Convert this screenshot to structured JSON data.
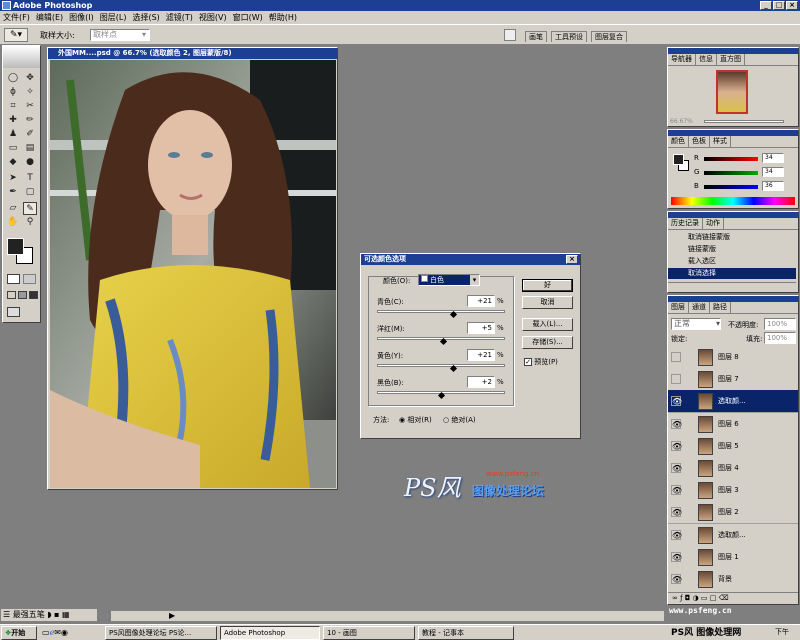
{
  "app": {
    "title": "Adobe Photoshop"
  },
  "menu": [
    "文件(F)",
    "编辑(E)",
    "图像(I)",
    "图层(L)",
    "选择(S)",
    "滤镜(T)",
    "视图(V)",
    "窗口(W)",
    "帮助(H)"
  ],
  "options": {
    "sample_label": "取样大小:",
    "sample_value": "取样点"
  },
  "palette_tabs": [
    "画笔",
    "工具预设",
    "图层复合"
  ],
  "document": {
    "title": "外国MM....psd @ 66.7% (选取颜色 2, 图层蒙版/8)"
  },
  "navigator": {
    "tabs": [
      "导航器",
      "信息",
      "直方图"
    ],
    "zoom": "66.67%"
  },
  "color_panel": {
    "tabs": [
      "颜色",
      "色板",
      "样式"
    ],
    "r": "34",
    "g": "34",
    "b": "36"
  },
  "history": {
    "tabs": [
      "历史记录",
      "动作"
    ],
    "items": [
      "取消链接蒙版",
      "链接蒙版",
      "载入选区",
      "取消选择"
    ]
  },
  "layers_panel": {
    "tabs": [
      "图层",
      "通道",
      "路径"
    ],
    "blend_mode": "正常",
    "opacity_label": "不透明度:",
    "opacity": "100%",
    "lock_label": "锁定:",
    "fill_label": "填充:",
    "fill": "100%",
    "layers": [
      {
        "name": "图层 8",
        "selected": false,
        "eye": false
      },
      {
        "name": "图层 7",
        "selected": false,
        "eye": false
      },
      {
        "name": "选取颜...",
        "selected": true,
        "eye": true
      },
      {
        "name": "图层 6",
        "selected": false,
        "eye": true
      },
      {
        "name": "图层 5",
        "selected": false,
        "eye": true
      },
      {
        "name": "图层 4",
        "selected": false,
        "eye": true
      },
      {
        "name": "图层 3",
        "selected": false,
        "eye": true
      },
      {
        "name": "图层 2",
        "selected": false,
        "eye": true
      },
      {
        "name": "选取颜...",
        "selected": false,
        "eye": true
      },
      {
        "name": "图层 1",
        "selected": false,
        "eye": true
      },
      {
        "name": "背景",
        "selected": false,
        "eye": true
      }
    ]
  },
  "dialog": {
    "title": "可选颜色选项",
    "colors_label": "颜色(O):",
    "colors_value": "白色",
    "ok": "好",
    "cancel": "取消",
    "load": "载入(L)...",
    "save": "存储(S)...",
    "preview": "预览(P)",
    "sliders": [
      {
        "label": "青色(C):",
        "value": "+21",
        "pct": 0.6
      },
      {
        "label": "洋红(M):",
        "value": "+5",
        "pct": 0.525
      },
      {
        "label": "黄色(Y):",
        "value": "+21",
        "pct": 0.6
      },
      {
        "label": "黑色(B):",
        "value": "+2",
        "pct": 0.51
      }
    ],
    "percent": "%",
    "method_label": "方法:",
    "method_relative": "相对(R)",
    "method_absolute": "绝对(A)"
  },
  "watermark": {
    "logo": "PS风",
    "forum": "图像处理论坛",
    "site": "www.psfeng.cn",
    "bottom_text": "PS风 图像处理网"
  },
  "lang_bar": {
    "label": "最强五笔"
  },
  "taskbar": {
    "start": "开始",
    "tasks": [
      "PS风图像处理论坛 PS论...",
      "Adobe Photoshop",
      "10 - 画图",
      "教程 - 记事本"
    ],
    "clock": "下午"
  }
}
